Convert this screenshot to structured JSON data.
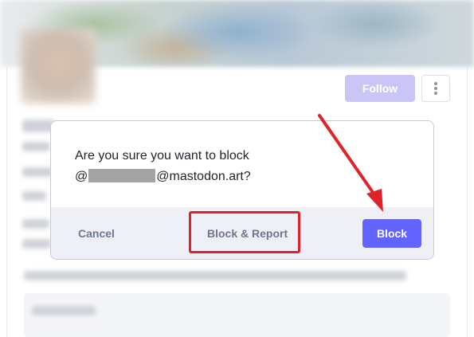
{
  "profile": {
    "follow_label": "Follow",
    "more_icon": "more-vertical-icon"
  },
  "dialog": {
    "message_line1": "Are you sure you want to block",
    "message_prefix": "@",
    "message_suffix": "@mastodon.art?",
    "cancel_label": "Cancel",
    "block_report_label": "Block & Report",
    "block_label": "Block"
  },
  "colors": {
    "accent": "#6364ff",
    "annotation_red": "#e0222b"
  }
}
